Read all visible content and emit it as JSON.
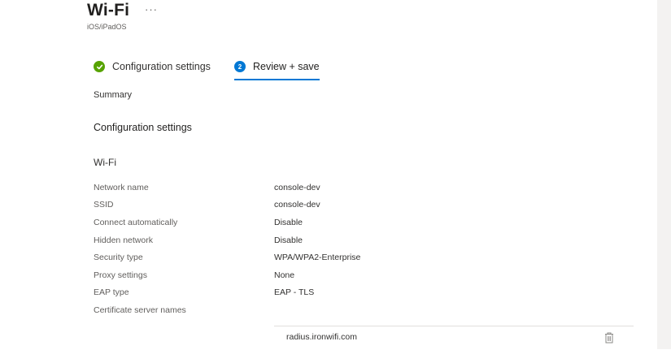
{
  "header": {
    "title": "Wi-Fi",
    "more_label": "···",
    "subtitle": "iOS/iPadOS"
  },
  "wizard": {
    "steps": [
      {
        "label": "Configuration settings",
        "state": "complete",
        "icon": "check-circle-icon"
      },
      {
        "label": "Review + save",
        "state": "current",
        "number": "2"
      }
    ]
  },
  "summary": {
    "label": "Summary",
    "section_heading": "Configuration settings",
    "group_heading": "Wi-Fi",
    "rows": [
      {
        "key": "Network name",
        "value": "console-dev"
      },
      {
        "key": "SSID",
        "value": "console-dev"
      },
      {
        "key": "Connect automatically",
        "value": "Disable"
      },
      {
        "key": "Hidden network",
        "value": "Disable"
      },
      {
        "key": "Security type",
        "value": "WPA/WPA2-Enterprise"
      },
      {
        "key": "Proxy settings",
        "value": "None"
      },
      {
        "key": "EAP type",
        "value": "EAP - TLS"
      },
      {
        "key": "Certificate server names",
        "value": ""
      }
    ],
    "certificate_servers": [
      {
        "name": "radius.ironwifi.com",
        "action_icon": "trash-icon"
      }
    ]
  },
  "colors": {
    "accent": "#0078d4",
    "success": "#57a300",
    "text_primary": "#323130",
    "text_secondary": "#605e5c"
  }
}
